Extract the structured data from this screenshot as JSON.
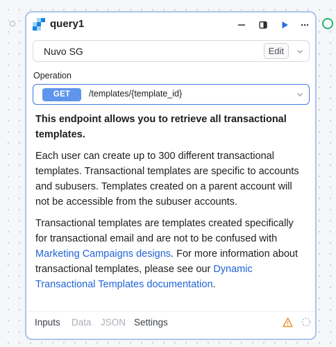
{
  "query": {
    "title": "query1",
    "icon": "sendgrid-icon",
    "actions": [
      "minimize-icon",
      "panel-toggle-icon",
      "run-play-icon",
      "more-options-icon"
    ]
  },
  "resource": {
    "name": "Nuvo SG",
    "edit_label": "Edit"
  },
  "operation": {
    "label": "Operation",
    "method": "GET",
    "path": "/templates/{template_id}"
  },
  "description": {
    "heading": "This endpoint allows you to retrieve all transactional templates.",
    "para1": "Each user can create up to 300 different transactional templates. Transactional templates are specific to accounts and subusers. Templates created on a parent account will not be accessible from the subuser accounts.",
    "para2_text1": "Transactional templates are templates created specifically for transactional email and are not to be confused with ",
    "para2_link1": "Marketing Campaigns designs",
    "para2_text2": ". For more information about transactional templates, please see our ",
    "para2_link2": "Dynamic Transactional Templates documentation",
    "para2_text3": "."
  },
  "footer": {
    "tabs": [
      {
        "label": "Inputs",
        "active": true
      },
      {
        "label": "Data",
        "active": false
      },
      {
        "label": "JSON",
        "active": false
      },
      {
        "label": "Settings",
        "active": true
      }
    ]
  },
  "colors": {
    "accent": "#3f79e0",
    "method_badge": "#5f95ec",
    "link": "#1f64d6",
    "warning": "#e8902f",
    "output_port": "#22b573",
    "card_border": "#a9c4ee"
  }
}
